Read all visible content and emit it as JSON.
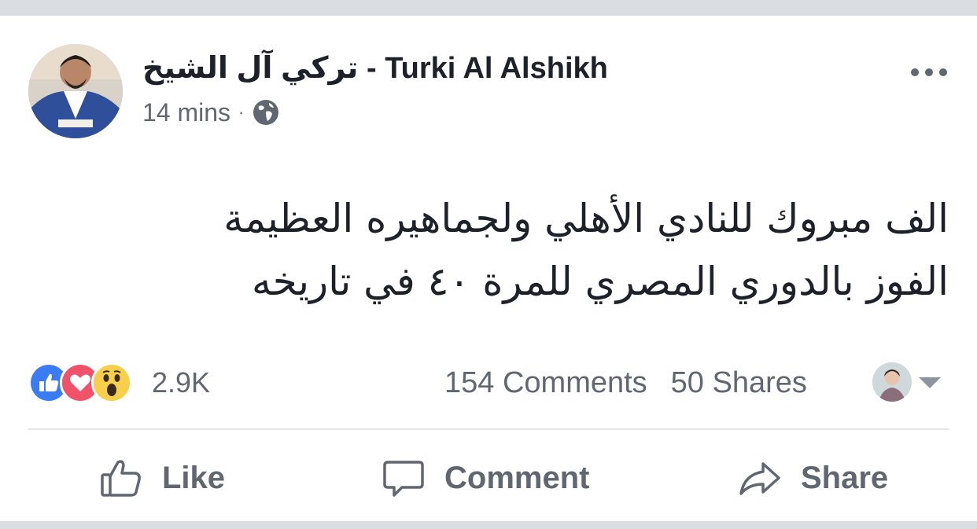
{
  "post": {
    "author_arabic": "تركي آل الشيخ",
    "author_separator": " - ",
    "author_latin": "Turki Al Alshikh",
    "time": "14 mins",
    "meta_dot": "·",
    "privacy_icon": "globe-icon",
    "menu_icon": "more-dots-icon",
    "text_lines": [
      "الف مبروك للنادي الأهلي ولجماهيره العظيمة",
      "الفوز بالدوري المصري للمرة ٤٠ في تاريخه"
    ]
  },
  "engagement": {
    "reaction_icons": [
      "like-reaction-icon",
      "love-reaction-icon",
      "wow-reaction-icon"
    ],
    "reaction_count": "2.9K",
    "comments": "154 Comments",
    "shares": "50 Shares"
  },
  "actions": {
    "like": "Like",
    "comment": "Comment",
    "share": "Share"
  },
  "colors": {
    "like_blue": "#3b7cf5",
    "love_red": "#f0526a",
    "wow_yellow": "#f7cf4a",
    "text_primary": "#1d2129",
    "text_secondary": "#616770",
    "band_gray": "#dadde1"
  }
}
